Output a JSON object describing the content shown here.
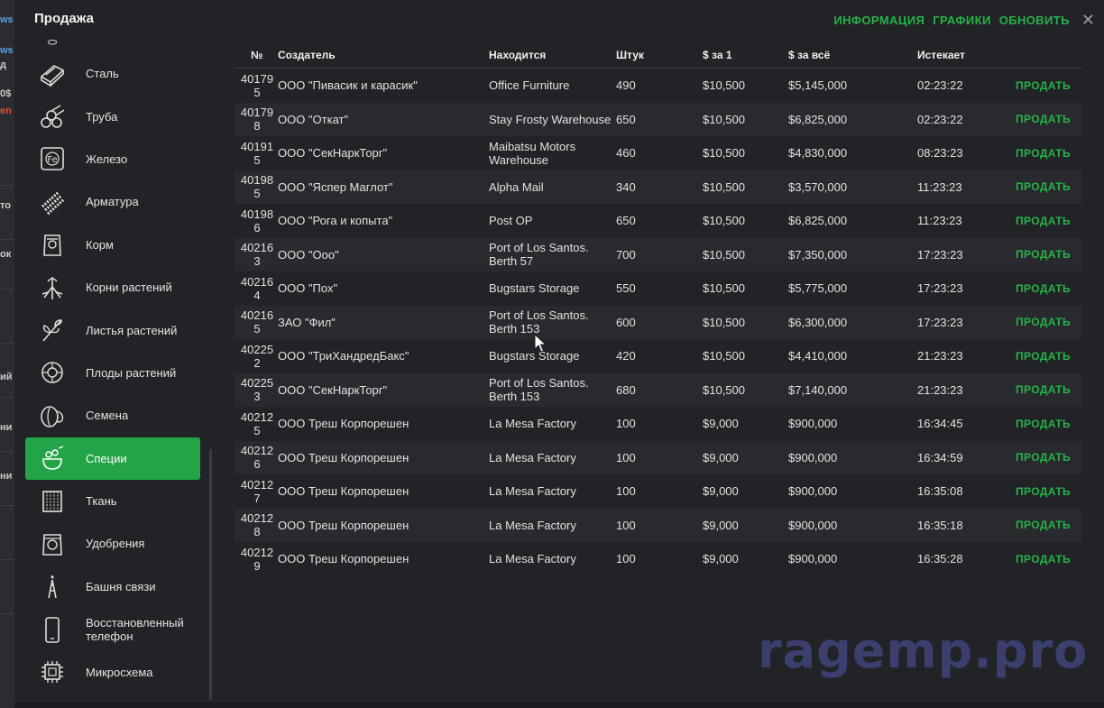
{
  "window": {
    "title": "Продажа",
    "links": [
      "ИНФОРМАЦИЯ",
      "ГРАФИКИ",
      "ОБНОВИТЬ"
    ],
    "close_glyph": "✕"
  },
  "background_tags": [
    "ws",
    "ws",
    "д",
    "0$",
    "en",
    "то",
    "ок",
    "ий",
    "ни",
    "ни"
  ],
  "sidebar": {
    "active_index": 10,
    "items": [
      {
        "label": "Сталь",
        "icon": "steel-icon"
      },
      {
        "label": "Труба",
        "icon": "pipe-icon"
      },
      {
        "label": "Железо",
        "icon": "iron-icon"
      },
      {
        "label": "Арматура",
        "icon": "rebar-icon"
      },
      {
        "label": "Корм",
        "icon": "feed-bag-icon"
      },
      {
        "label": "Корни растений",
        "icon": "roots-icon"
      },
      {
        "label": "Листья растений",
        "icon": "leaves-icon"
      },
      {
        "label": "Плоды растений",
        "icon": "fruit-icon"
      },
      {
        "label": "Семена",
        "icon": "seeds-icon"
      },
      {
        "label": "Специи",
        "icon": "spice-icon"
      },
      {
        "label": "Ткань",
        "icon": "fabric-icon"
      },
      {
        "label": "Удобрения",
        "icon": "fertilizer-icon"
      },
      {
        "label": "Башня связи",
        "icon": "tower-icon"
      },
      {
        "label": "Восстановленный телефон",
        "icon": "phone-icon"
      },
      {
        "label": "Микросхема",
        "icon": "chip-icon"
      }
    ]
  },
  "table": {
    "headers": [
      "№",
      "Создатель",
      "Находится",
      "Штук",
      "$ за 1",
      "$ за всё",
      "Истекает",
      ""
    ],
    "sell_label": "ПРОДАТЬ",
    "rows": [
      [
        "401795",
        "ООО \"Пивасик и карасик\"",
        "Office Furniture",
        "490",
        "$10,500",
        "$5,145,000",
        "02:23:22"
      ],
      [
        "401798",
        "ООО \"Откат\"",
        "Stay Frosty Warehouse",
        "650",
        "$10,500",
        "$6,825,000",
        "02:23:22"
      ],
      [
        "401915",
        "ООО \"СекНаркТорг\"",
        "Maibatsu Motors Warehouse",
        "460",
        "$10,500",
        "$4,830,000",
        "08:23:23"
      ],
      [
        "401985",
        "ООО \"Яспер Маглот\"",
        "Alpha Mail",
        "340",
        "$10,500",
        "$3,570,000",
        "11:23:23"
      ],
      [
        "401986",
        "ООО \"Рога и копыта\"",
        "Post OP",
        "650",
        "$10,500",
        "$6,825,000",
        "11:23:23"
      ],
      [
        "402163",
        "ООО \"Ооо\"",
        "Port of Los Santos. Berth 57",
        "700",
        "$10,500",
        "$7,350,000",
        "17:23:23"
      ],
      [
        "402164",
        "ООО \"Пох\"",
        "Bugstars Storage",
        "550",
        "$10,500",
        "$5,775,000",
        "17:23:23"
      ],
      [
        "402165",
        "ЗАО \"Фил\"",
        "Port of Los Santos. Berth 153",
        "600",
        "$10,500",
        "$6,300,000",
        "17:23:23"
      ],
      [
        "402252",
        "ООО \"ТриХандредБакс\"",
        "Bugstars Storage",
        "420",
        "$10,500",
        "$4,410,000",
        "21:23:23"
      ],
      [
        "402253",
        "ООО \"СекНаркТорг\"",
        "Port of Los Santos. Berth 153",
        "680",
        "$10,500",
        "$7,140,000",
        "21:23:23"
      ],
      [
        "402125",
        "ООО Треш Корпорешен",
        "La Mesa Factory",
        "100",
        "$9,000",
        "$900,000",
        "16:34:45"
      ],
      [
        "402126",
        "ООО Треш Корпорешен",
        "La Mesa Factory",
        "100",
        "$9,000",
        "$900,000",
        "16:34:59"
      ],
      [
        "402127",
        "ООО Треш Корпорешен",
        "La Mesa Factory",
        "100",
        "$9,000",
        "$900,000",
        "16:35:08"
      ],
      [
        "402128",
        "ООО Треш Корпорешен",
        "La Mesa Factory",
        "100",
        "$9,000",
        "$900,000",
        "16:35:18"
      ],
      [
        "402129",
        "ООО Треш Корпорешен",
        "La Mesa Factory",
        "100",
        "$9,000",
        "$900,000",
        "16:35:28"
      ]
    ]
  },
  "watermark": "ragemp.pro",
  "colors": {
    "accent": "#22a447",
    "link": "#27b24a",
    "panel": "#212326",
    "row_alt": "#282a2e"
  }
}
